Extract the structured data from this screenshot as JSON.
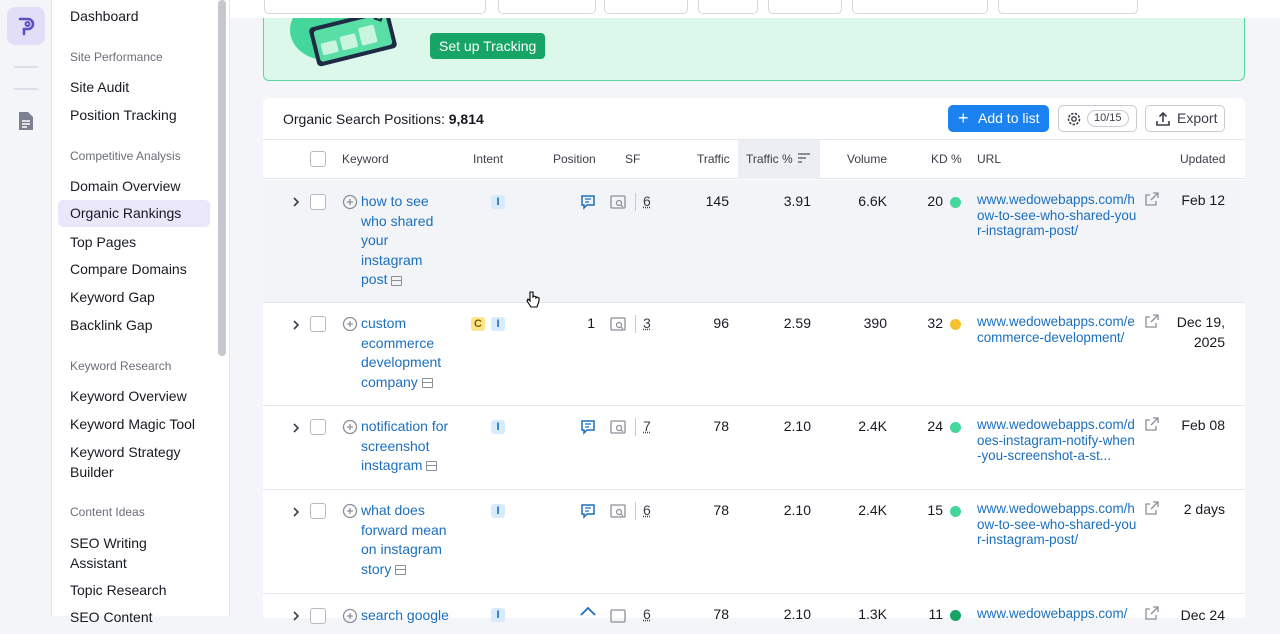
{
  "sidebar": {
    "items": [
      {
        "label": "Dashboard",
        "active": false
      },
      {
        "group": "Site Performance"
      },
      {
        "label": "Site Audit",
        "active": false
      },
      {
        "label": "Position Tracking",
        "active": false
      },
      {
        "group": "Competitive Analysis"
      },
      {
        "label": "Domain Overview",
        "active": false
      },
      {
        "label": "Organic Rankings",
        "active": true
      },
      {
        "label": "Top Pages",
        "active": false
      },
      {
        "label": "Compare Domains",
        "active": false
      },
      {
        "label": "Keyword Gap",
        "active": false
      },
      {
        "label": "Backlink Gap",
        "active": false
      },
      {
        "group": "Keyword Research"
      },
      {
        "label": "Keyword Overview",
        "active": false
      },
      {
        "label": "Keyword Magic Tool",
        "active": false
      },
      {
        "label": "Keyword Strategy Builder",
        "active": false
      },
      {
        "group": "Content Ideas"
      },
      {
        "label": "SEO Writing Assistant",
        "active": false
      },
      {
        "label": "Topic Research",
        "active": false
      },
      {
        "label": "SEO Content",
        "active": false
      }
    ]
  },
  "banner": {
    "button_label": "Set up Tracking"
  },
  "table_header": {
    "title_prefix": "Organic Search Positions:",
    "total": "9,814",
    "add_to_list": "Add to list",
    "columns_count": "10/15",
    "export": "Export"
  },
  "columns": [
    "Keyword",
    "Intent",
    "Position",
    "SF",
    "Traffic",
    "Traffic %",
    "Volume",
    "KD %",
    "URL",
    "Updated"
  ],
  "rows": [
    {
      "keyword": "how to see who shared your instagram post",
      "intent": [
        "I"
      ],
      "position_icon": "featured-snippet",
      "position": "",
      "sf": "6",
      "traffic": "145",
      "traffic_pct": "3.91",
      "volume": "6.6K",
      "kd": "20",
      "kd_color": "#45d69b",
      "url": "www.wedowebapps.com/how-to-see-who-shared-your-instagram-post/",
      "updated": "Feb 12"
    },
    {
      "keyword": "custom ecommerce development company",
      "intent": [
        "C",
        "I"
      ],
      "position_icon": "",
      "position": "1",
      "sf": "3",
      "traffic": "96",
      "traffic_pct": "2.59",
      "volume": "390",
      "kd": "32",
      "kd_color": "#f2c230",
      "url": "www.wedowebapps.com/ecommerce-development/",
      "updated": "Dec 19, 2025"
    },
    {
      "keyword": "notification for screenshot instagram",
      "intent": [
        "I"
      ],
      "position_icon": "featured-snippet",
      "position": "",
      "sf": "7",
      "traffic": "78",
      "traffic_pct": "2.10",
      "volume": "2.4K",
      "kd": "24",
      "kd_color": "#45d69b",
      "url": "www.wedowebapps.com/does-instagram-notify-when-you-screenshot-a-st...",
      "updated": "Feb 08"
    },
    {
      "keyword": "what does forward mean on instagram story",
      "intent": [
        "I"
      ],
      "position_icon": "featured-snippet",
      "position": "",
      "sf": "6",
      "traffic": "78",
      "traffic_pct": "2.10",
      "volume": "2.4K",
      "kd": "15",
      "kd_color": "#45d69b",
      "url": "www.wedowebapps.com/how-to-see-who-shared-your-instagram-post/",
      "updated": "2 days"
    },
    {
      "keyword": "search google",
      "intent": [
        "I"
      ],
      "position_icon": "",
      "position": "",
      "sf": "6",
      "traffic": "78",
      "traffic_pct": "2.10",
      "volume": "1.3K",
      "kd": "11",
      "kd_color": "#17a567",
      "url": "www.wedowebapps.com/",
      "updated": "Dec 24"
    }
  ]
}
